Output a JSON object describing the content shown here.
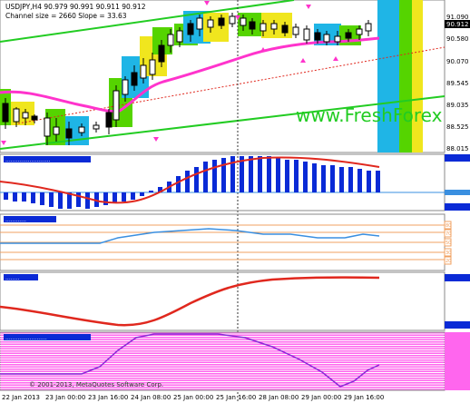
{
  "main": {
    "title": "USDJPY,H4  90.979 90.991 90.911 90.912",
    "subtitle": "Channel size = 2660 Slope = 33.63",
    "watermark": "www.FreshForex",
    "price_ticks": [
      "91.090",
      "90.912",
      "90.580",
      "90.070",
      "89.545",
      "89.035",
      "88.525",
      "88.015"
    ],
    "current_price": "90.912"
  },
  "panels": [
    {
      "id": "histogram",
      "label": "..........................",
      "axis": [
        "",
        "",
        ""
      ]
    },
    {
      "id": "rsi",
      "label": "............",
      "axis": [
        "80",
        "70",
        "50",
        "30",
        "20"
      ]
    },
    {
      "id": "ma",
      "label": "........",
      "axis": [
        "",
        ""
      ]
    },
    {
      "id": "stoch",
      "label": "........................",
      "axis": []
    }
  ],
  "time_axis": [
    "22 Jan 2013",
    "23 Jan 00:00",
    "23 Jan 16:00",
    "24 Jan 08:00",
    "25 Jan 00:00",
    "25 Jan 16:00",
    "28 Jan 08:00",
    "29 Jan 00:00",
    "29 Jan 16:00"
  ],
  "copyright": "© 2001-2013, MetaQuotes Software Corp.",
  "colors": {
    "cyan": "#1fb5e6",
    "green": "#55d400",
    "yellow": "#f0e61e",
    "magenta": "#ff33cc",
    "channel": "#22cc22",
    "histo": "#0a2ad6",
    "red": "#e0281e",
    "rsi": "#3a8fe0",
    "stoch": "#8a2ad6",
    "grid": "#eeeeee"
  }
}
